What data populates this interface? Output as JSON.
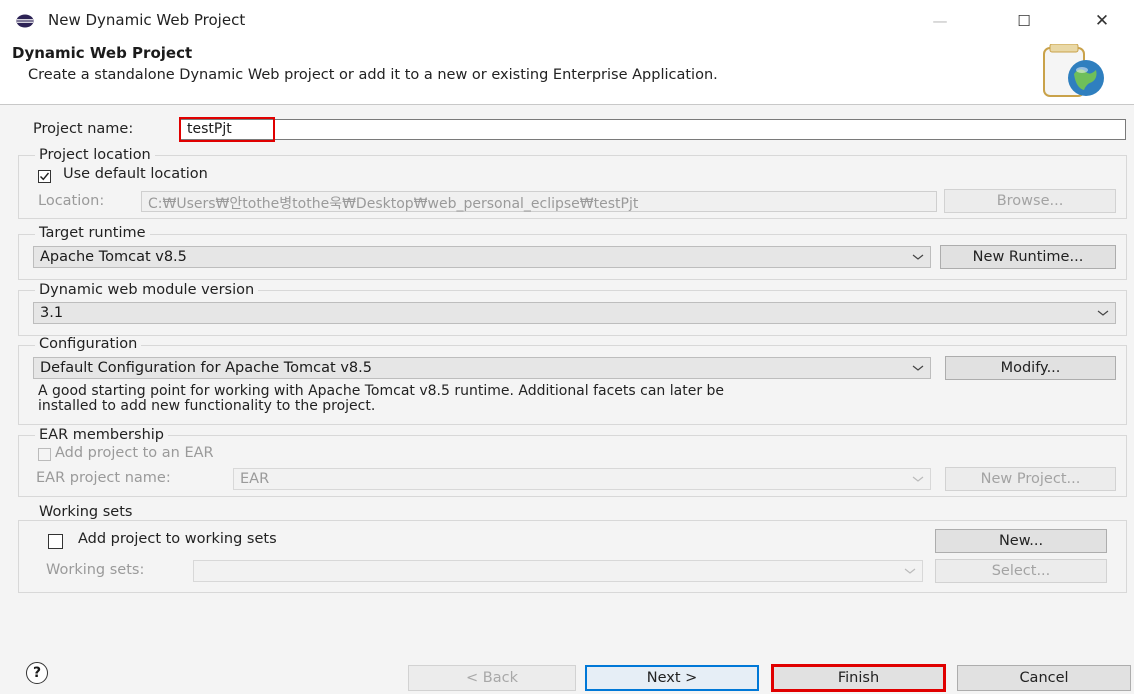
{
  "window": {
    "title": "New Dynamic Web Project",
    "minimize_symbol": "—",
    "maximize_symbol": "☐",
    "close_symbol": "✕"
  },
  "header": {
    "title": "Dynamic Web Project",
    "description": "Create a standalone Dynamic Web project or add it to a new or existing Enterprise Application."
  },
  "project_name": {
    "label": "Project name:",
    "value": "testPjt"
  },
  "project_location": {
    "group_label": "Project location",
    "use_default_label": "Use default location",
    "use_default_checked": true,
    "location_label": "Location:",
    "location_value": "C:₩Users₩안tothe병tothe욱₩Desktop₩web_personal_eclipse₩testPjt",
    "browse_label": "Browse..."
  },
  "target_runtime": {
    "group_label": "Target runtime",
    "selected": "Apache Tomcat v8.5",
    "new_runtime_label": "New Runtime..."
  },
  "module_version": {
    "group_label": "Dynamic web module version",
    "selected": "3.1"
  },
  "configuration": {
    "group_label": "Configuration",
    "selected": "Default Configuration for Apache Tomcat v8.5",
    "modify_label": "Modify...",
    "description_line1": "A good starting point for working with Apache Tomcat v8.5 runtime. Additional facets can later be",
    "description_line2": "installed to add new functionality to the project."
  },
  "ear": {
    "group_label": "EAR membership",
    "add_label": "Add project to an EAR",
    "name_label": "EAR project name:",
    "name_value": "EAR",
    "new_project_label": "New Project..."
  },
  "working_sets": {
    "group_label": "Working sets",
    "add_label": "Add project to working sets",
    "new_label": "New...",
    "sets_label": "Working sets:",
    "select_label": "Select..."
  },
  "footer": {
    "help_symbol": "?",
    "back_label": "< Back",
    "next_label": "Next >",
    "finish_label": "Finish",
    "cancel_label": "Cancel"
  },
  "colors": {
    "highlight": "#e00000",
    "focus_blue": "#0078d7"
  },
  "icons": {
    "app": "eclipse-icon",
    "dropdown": "chevron-down-icon",
    "check": "check-icon",
    "help": "help-icon"
  }
}
